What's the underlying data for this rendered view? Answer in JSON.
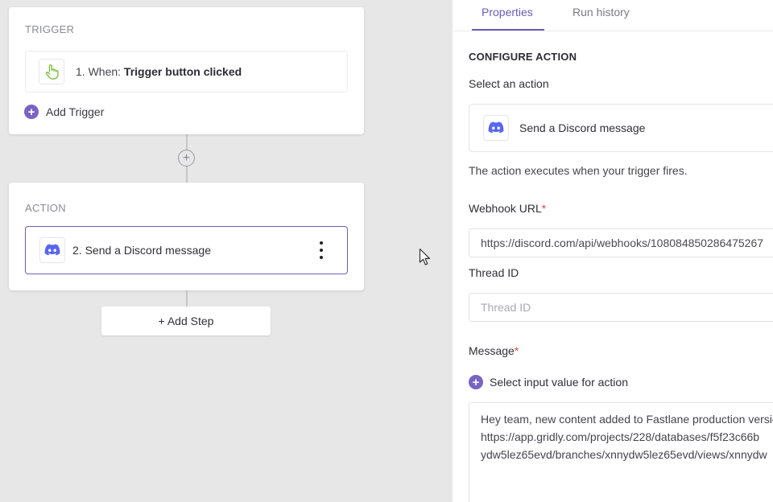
{
  "canvas": {
    "trigger_card": {
      "label": "TRIGGER",
      "step_prefix": "1. When: ",
      "step_name": "Trigger button clicked",
      "add_label": "Add Trigger"
    },
    "action_card": {
      "label": "ACTION",
      "step_label": "2. Send a Discord message"
    },
    "add_step_label": "+ Add Step",
    "connector_plus": "+"
  },
  "panel": {
    "tabs": [
      {
        "label": "Properties",
        "active": true
      },
      {
        "label": "Run history",
        "active": false
      }
    ],
    "section_title": "CONFIGURE ACTION",
    "select_action_label": "Select an action",
    "selected_action": "Send a Discord message",
    "helper_text": "The action executes when your trigger fires.",
    "webhook": {
      "label": "Webhook URL",
      "required_mark": "*",
      "value": "https://discord.com/api/webhooks/108084850286475267"
    },
    "thread": {
      "label": "Thread ID",
      "placeholder": "Thread ID",
      "value": ""
    },
    "message": {
      "label": "Message",
      "required_mark": "*",
      "select_input_label": "Select input value for action",
      "value": "Hey team, new content added to Fastlane production versio\nhttps://app.gridly.com/projects/228/databases/f5f23c66b\nydw5lez65evd/branches/xnnydw5lez65evd/views/xnnydw"
    }
  },
  "icons": {
    "trigger": "hand-pointer-icon",
    "discord": "discord-icon",
    "more": "kebab-menu-icon",
    "cursor": "mouse-pointer-icon"
  },
  "colors": {
    "accent": "#6a5bc0",
    "plus_badge": "#7a63c3",
    "discord": "#5865f2",
    "trigger_icon": "#7fbf3f",
    "required": "#e04848"
  }
}
